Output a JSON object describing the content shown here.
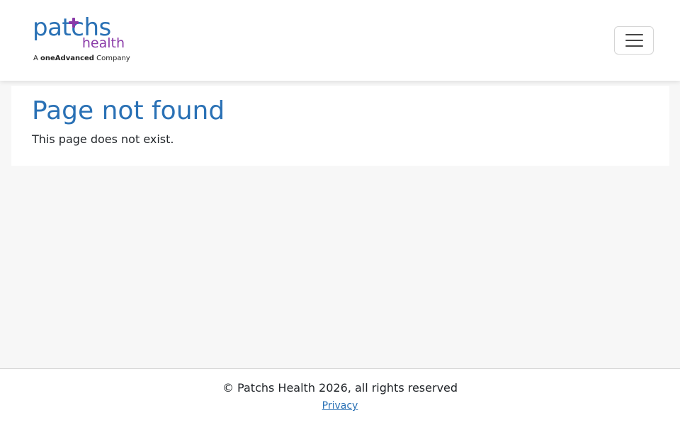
{
  "header": {
    "logo": {
      "brand": "patchs",
      "sub": "health",
      "tagline_prefix": "A",
      "tagline_brand": "oneAdvanced",
      "tagline_suffix": "Company",
      "colors": {
        "primary": "#2a71b5",
        "accent": "#8a3aa8"
      }
    },
    "menu_toggle_icon": "hamburger-menu-icon"
  },
  "main": {
    "title": "Page not found",
    "message": "This page does not exist."
  },
  "footer": {
    "copyright": "© Patchs Health 2026, all rights reserved",
    "privacy_link": "Privacy"
  }
}
